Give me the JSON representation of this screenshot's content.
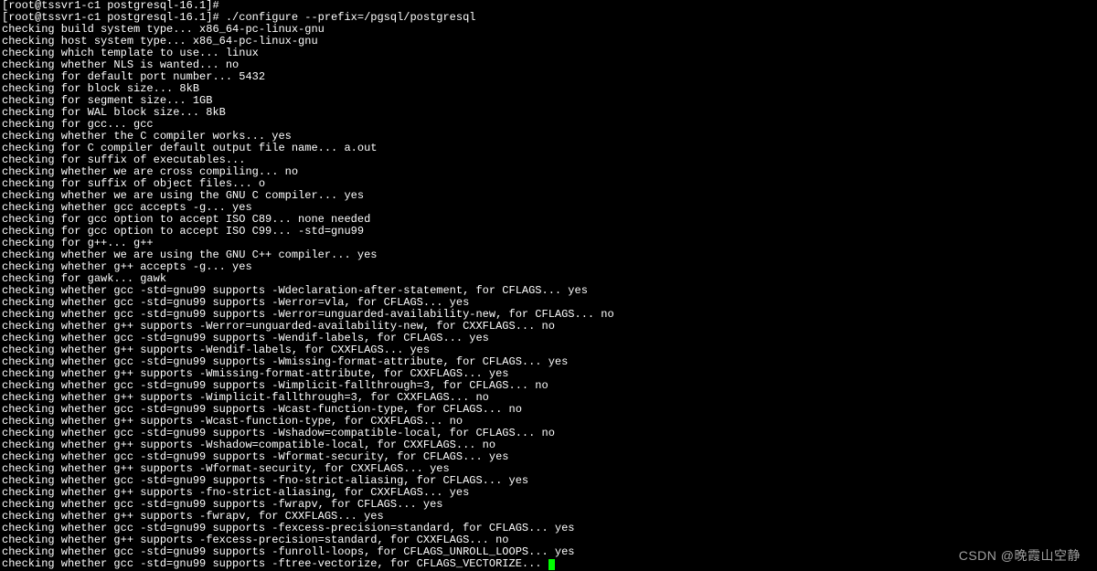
{
  "terminal": {
    "lines": [
      "[root@tssvr1-c1 postgresql-16.1]#",
      "[root@tssvr1-c1 postgresql-16.1]# ./configure --prefix=/pgsql/postgresql",
      "checking build system type... x86_64-pc-linux-gnu",
      "checking host system type... x86_64-pc-linux-gnu",
      "checking which template to use... linux",
      "checking whether NLS is wanted... no",
      "checking for default port number... 5432",
      "checking for block size... 8kB",
      "checking for segment size... 1GB",
      "checking for WAL block size... 8kB",
      "checking for gcc... gcc",
      "checking whether the C compiler works... yes",
      "checking for C compiler default output file name... a.out",
      "checking for suffix of executables...",
      "checking whether we are cross compiling... no",
      "checking for suffix of object files... o",
      "checking whether we are using the GNU C compiler... yes",
      "checking whether gcc accepts -g... yes",
      "checking for gcc option to accept ISO C89... none needed",
      "checking for gcc option to accept ISO C99... -std=gnu99",
      "checking for g++... g++",
      "checking whether we are using the GNU C++ compiler... yes",
      "checking whether g++ accepts -g... yes",
      "checking for gawk... gawk",
      "checking whether gcc -std=gnu99 supports -Wdeclaration-after-statement, for CFLAGS... yes",
      "checking whether gcc -std=gnu99 supports -Werror=vla, for CFLAGS... yes",
      "checking whether gcc -std=gnu99 supports -Werror=unguarded-availability-new, for CFLAGS... no",
      "checking whether g++ supports -Werror=unguarded-availability-new, for CXXFLAGS... no",
      "checking whether gcc -std=gnu99 supports -Wendif-labels, for CFLAGS... yes",
      "checking whether g++ supports -Wendif-labels, for CXXFLAGS... yes",
      "checking whether gcc -std=gnu99 supports -Wmissing-format-attribute, for CFLAGS... yes",
      "checking whether g++ supports -Wmissing-format-attribute, for CXXFLAGS... yes",
      "checking whether gcc -std=gnu99 supports -Wimplicit-fallthrough=3, for CFLAGS... no",
      "checking whether g++ supports -Wimplicit-fallthrough=3, for CXXFLAGS... no",
      "checking whether gcc -std=gnu99 supports -Wcast-function-type, for CFLAGS... no",
      "checking whether g++ supports -Wcast-function-type, for CXXFLAGS... no",
      "checking whether gcc -std=gnu99 supports -Wshadow=compatible-local, for CFLAGS... no",
      "checking whether g++ supports -Wshadow=compatible-local, for CXXFLAGS... no",
      "checking whether gcc -std=gnu99 supports -Wformat-security, for CFLAGS... yes",
      "checking whether g++ supports -Wformat-security, for CXXFLAGS... yes",
      "checking whether gcc -std=gnu99 supports -fno-strict-aliasing, for CFLAGS... yes",
      "checking whether g++ supports -fno-strict-aliasing, for CXXFLAGS... yes",
      "checking whether gcc -std=gnu99 supports -fwrapv, for CFLAGS... yes",
      "checking whether g++ supports -fwrapv, for CXXFLAGS... yes",
      "checking whether gcc -std=gnu99 supports -fexcess-precision=standard, for CFLAGS... yes",
      "checking whether g++ supports -fexcess-precision=standard, for CXXFLAGS... no",
      "checking whether gcc -std=gnu99 supports -funroll-loops, for CFLAGS_UNROLL_LOOPS... yes",
      "checking whether gcc -std=gnu99 supports -ftree-vectorize, for CFLAGS_VECTORIZE... "
    ]
  },
  "watermark": "CSDN @晚霞山空静"
}
